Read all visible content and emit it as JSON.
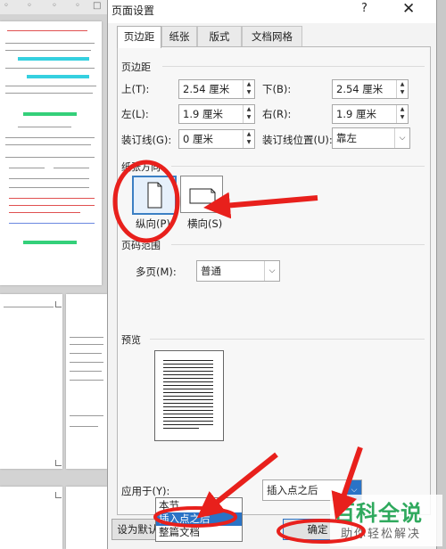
{
  "dialog": {
    "title": "页面设置",
    "help": "?",
    "close": "✕"
  },
  "tabs": [
    {
      "label": "页边距",
      "active": true
    },
    {
      "label": "纸张"
    },
    {
      "label": "版式"
    },
    {
      "label": "文档网格"
    }
  ],
  "margins": {
    "section": "页边距",
    "top_label": "上(T):",
    "top_value": "2.54 厘米",
    "bottom_label": "下(B):",
    "bottom_value": "2.54 厘米",
    "left_label": "左(L):",
    "left_value": "1.9 厘米",
    "right_label": "右(R):",
    "right_value": "1.9 厘米",
    "gutter_label": "装订线(G):",
    "gutter_value": "0 厘米",
    "gutter_pos_label": "装订线位置(U):",
    "gutter_pos_value": "靠左"
  },
  "orientation": {
    "section": "纸张方向",
    "portrait": "纵向(P)",
    "landscape": "横向(S)",
    "selected": "portrait"
  },
  "pages": {
    "section": "页码范围",
    "multiple_label": "多页(M):",
    "multiple_value": "普通"
  },
  "preview": {
    "section": "预览"
  },
  "apply": {
    "label": "应用于(Y):",
    "value": "插入点之后",
    "options": [
      "本节",
      "插入点之后",
      "整篇文档"
    ],
    "selected": "插入点之后"
  },
  "buttons": {
    "default": "设为默认值(D)",
    "ok": "确定"
  },
  "watermark": {
    "title": "百科全说",
    "subtitle": "助你轻松解决"
  },
  "colors": {
    "annotation_red": "#e8201c",
    "selection_blue": "#2a73c6",
    "watermark_green": "#2fa95d"
  }
}
